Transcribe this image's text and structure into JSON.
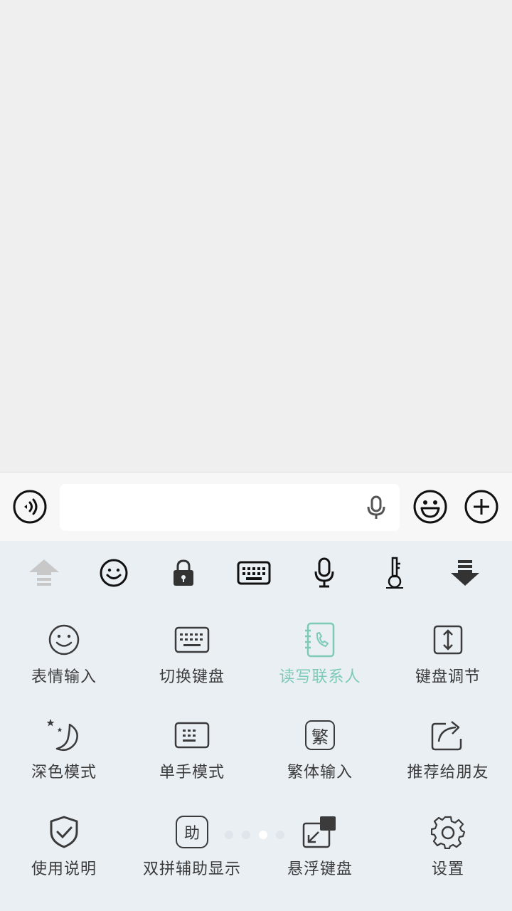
{
  "input_bar": {
    "text_value": "",
    "icons": [
      "voice-wave-icon",
      "microphone-icon",
      "smile-emoji-icon",
      "plus-icon"
    ]
  },
  "toolbar": {
    "icons": [
      "arrow-up-icon",
      "smiley-icon",
      "lock-icon",
      "keyboard-icon",
      "microphone-icon",
      "key-icon",
      "arrow-down-icon"
    ]
  },
  "grid": {
    "items": [
      {
        "label": "表情输入",
        "icon": "smiley-icon"
      },
      {
        "label": "切换键盘",
        "icon": "keyboard-icon"
      },
      {
        "label": "读写联系人",
        "icon": "contacts-book-icon",
        "active": true
      },
      {
        "label": "键盘调节",
        "icon": "resize-vertical-icon"
      },
      {
        "label": "深色模式",
        "icon": "moon-stars-icon"
      },
      {
        "label": "单手模式",
        "icon": "small-keyboard-icon"
      },
      {
        "label": "繁体输入",
        "icon": "traditional-char-icon",
        "glyph": "繁"
      },
      {
        "label": "推荐给朋友",
        "icon": "share-icon"
      },
      {
        "label": "使用说明",
        "icon": "shield-check-icon"
      },
      {
        "label": "双拼辅助显示",
        "icon": "assist-char-icon",
        "glyph": "助"
      },
      {
        "label": "悬浮键盘",
        "icon": "floating-keyboard-icon"
      },
      {
        "label": "设置",
        "icon": "gear-icon"
      }
    ]
  },
  "pager": {
    "count": 4,
    "current": 3
  },
  "colors": {
    "accent": "#7ecab8",
    "panel_bg": "#eaeff4",
    "chat_bg": "#efefef",
    "icon": "#333333"
  }
}
